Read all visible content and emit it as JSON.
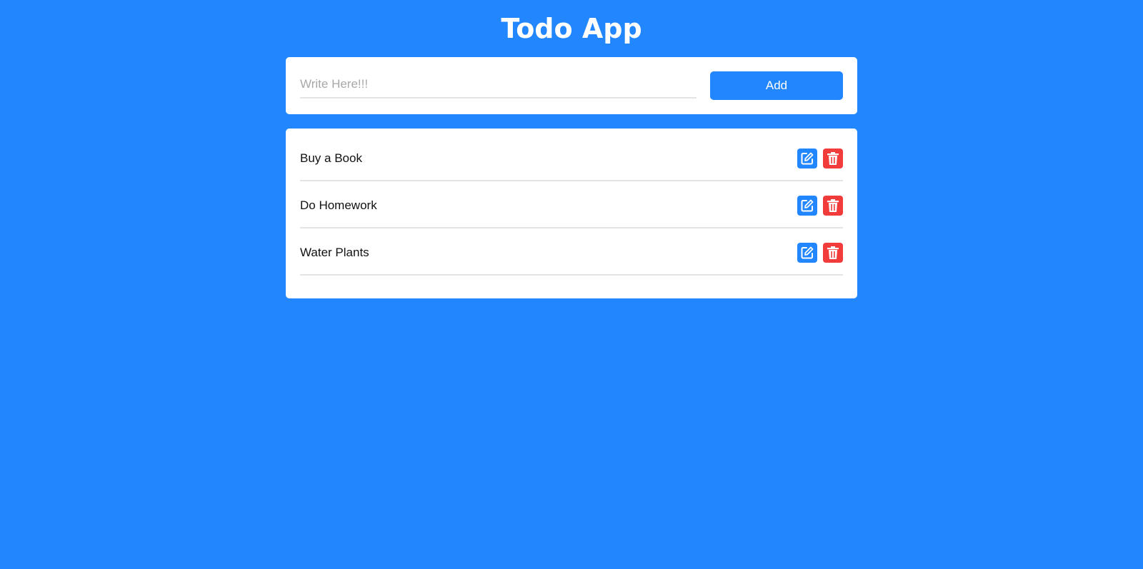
{
  "app": {
    "title": "Todo App"
  },
  "input": {
    "placeholder": "Write Here!!!",
    "value": ""
  },
  "add_button": {
    "label": "Add"
  },
  "todos": [
    {
      "text": "Buy a Book"
    },
    {
      "text": "Do Homework"
    },
    {
      "text": "Water Plants"
    }
  ],
  "icons": {
    "edit": "edit-icon",
    "delete": "trash-icon"
  },
  "colors": {
    "background": "#2287ff",
    "accent": "#2287ff",
    "danger": "#f23b3b",
    "card": "#ffffff"
  }
}
